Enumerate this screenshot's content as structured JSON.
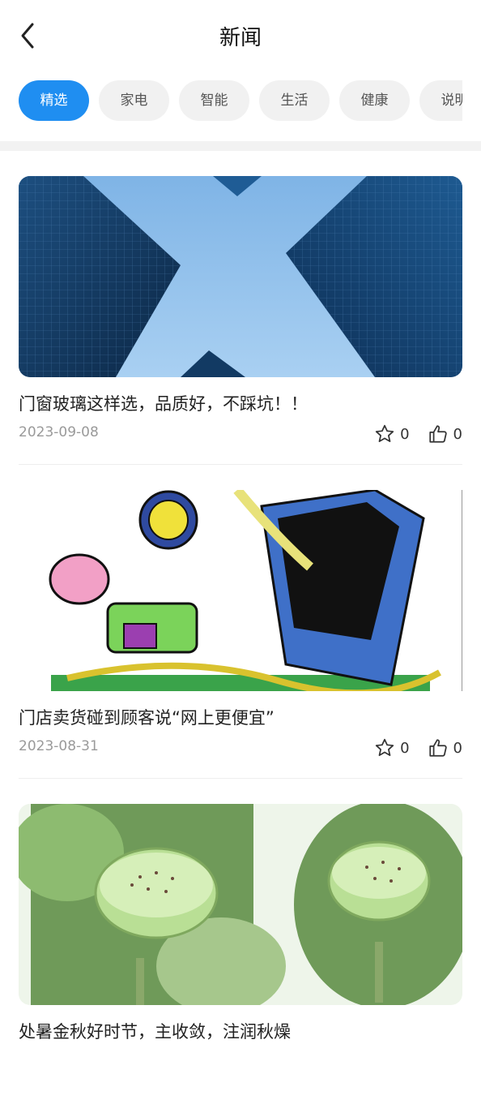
{
  "header": {
    "title": "新闻",
    "back_icon": "chevron-left-icon"
  },
  "tabs": [
    {
      "label": "精选",
      "active": true
    },
    {
      "label": "家电",
      "active": false
    },
    {
      "label": "智能",
      "active": false
    },
    {
      "label": "生活",
      "active": false
    },
    {
      "label": "健康",
      "active": false
    },
    {
      "label": "说明",
      "active": false
    }
  ],
  "news": [
    {
      "title": "门窗玻璃这样选，品质好，不踩坑！！",
      "date": "2023-09-08",
      "favorites": "0",
      "likes": "0"
    },
    {
      "title": "门店卖货碰到顾客说“网上更便宜”",
      "date": "2023-08-31",
      "favorites": "0",
      "likes": "0"
    },
    {
      "title": "处暑金秋好时节，主收敛，注润秋燥"
    }
  ],
  "colors": {
    "accent": "#1f8ef1",
    "tab_bg": "#f1f1f1",
    "date": "#9a9a9a"
  }
}
